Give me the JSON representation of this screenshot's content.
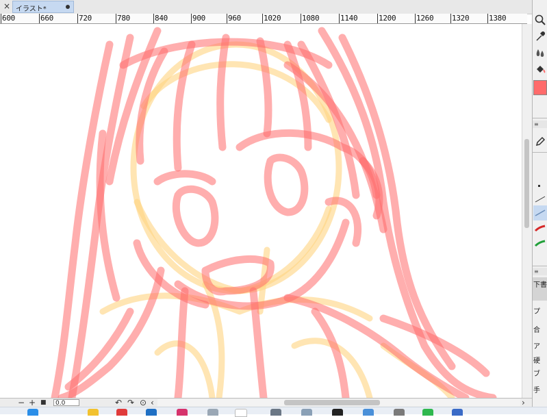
{
  "document_tab": {
    "title": "イラスト*",
    "close_glyph": "×",
    "modified_indicator": "●"
  },
  "ruler": {
    "ticks": [
      "600",
      "660",
      "720",
      "780",
      "840",
      "900",
      "960",
      "1020",
      "1080",
      "1140",
      "1200",
      "1260",
      "1320",
      "1380"
    ]
  },
  "status_bar": {
    "minus": "−",
    "plus": "+",
    "fit": "■",
    "zoom_value": "0.0",
    "rotate_ccw": "↶",
    "rotate_cw": "↷",
    "reset_rotation": "⊙",
    "scroll_left": "‹",
    "scroll_right": "›"
  },
  "side_panel": {
    "menu_glyph": "≡",
    "tools": [
      {
        "name": "zoom-icon",
        "glyph": "⌕"
      },
      {
        "name": "eyedropper-icon",
        "glyph": "✎"
      },
      {
        "name": "blend-icon",
        "glyph": "♦"
      },
      {
        "name": "fill-bucket-icon",
        "glyph": "◆"
      }
    ],
    "main_color": "#ff6b6b",
    "subtool_labels": [
      "下書",
      "プ",
      "合",
      "ア",
      "硬",
      "ブ",
      "手"
    ]
  },
  "colors": {
    "sketch_red": "#ff6b6b",
    "sketch_yellow": "#ffd480",
    "tab_active": "#c6d9f1"
  }
}
